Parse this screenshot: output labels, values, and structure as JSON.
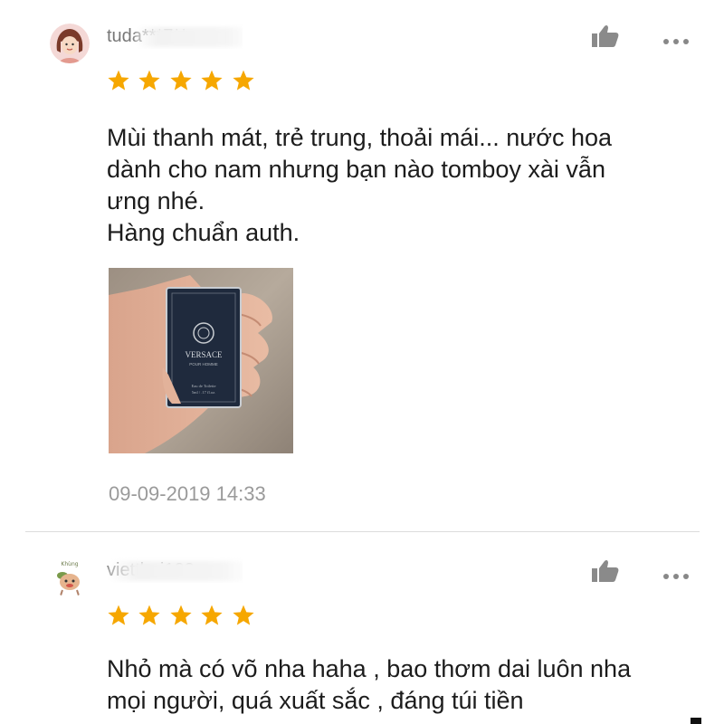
{
  "reviews": [
    {
      "username": "tuda***7**",
      "rating": 5,
      "text_lines": [
        "Mùi thanh mát, trẻ trung, thoải mái... nước hoa",
        "dành cho nam nhưng bạn nào tomboy xài vẫn",
        "ưng nhé.",
        "Hàng chuẩn auth."
      ],
      "photo": {
        "brand": "VERSACE",
        "sub": "POUR HOMME",
        "line1": "Eau de Toilette",
        "line2": "5ml / .17 fl.oz."
      },
      "timestamp": "09-09-2019 14:33"
    },
    {
      "username": "vietthai123",
      "avatar_caption": "Khùng",
      "rating": 5,
      "text_lines": [
        "Nhỏ mà có võ nha haha , bao thơm dai luôn nha",
        "mọi người, quá xuất sắc , đáng túi tiền"
      ]
    }
  ],
  "icons": {
    "like": "thumbs-up-icon",
    "more": "more-dots-icon",
    "star": "star-icon"
  },
  "colors": {
    "star": "#f6a700",
    "muted_text": "#9a9a9a",
    "icon": "#8a8a8a"
  }
}
